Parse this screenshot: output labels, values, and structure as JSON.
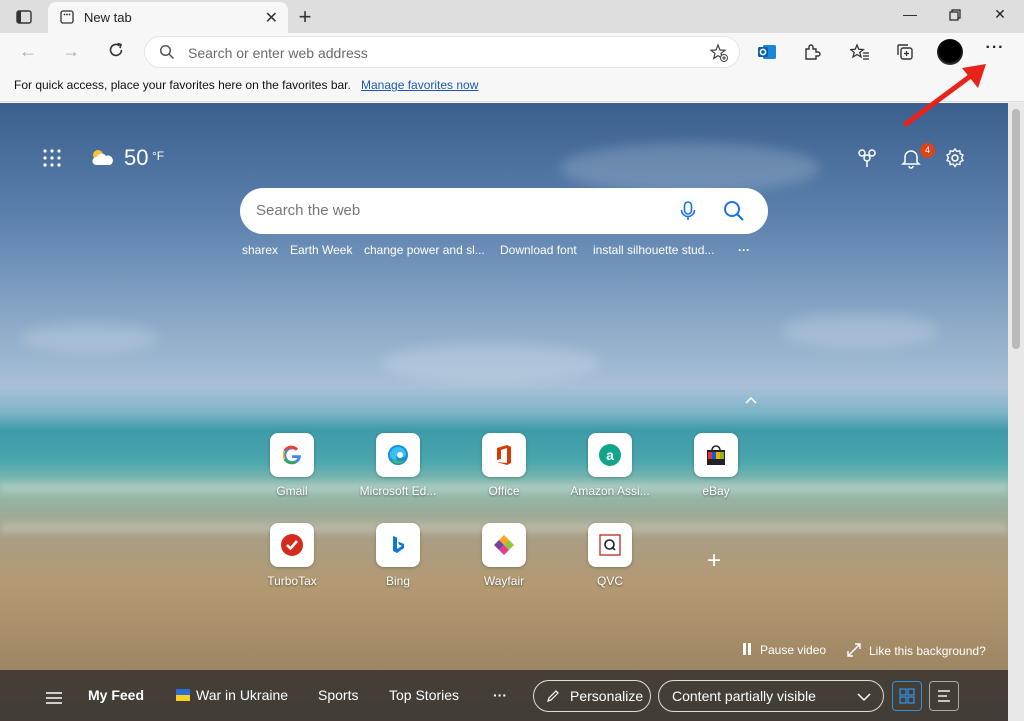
{
  "tab": {
    "title": "New tab"
  },
  "address": {
    "placeholder": "Search or enter web address"
  },
  "favorites_bar": {
    "message": "For quick access, place your favorites here on the favorites bar.",
    "link": "Manage favorites now"
  },
  "weather": {
    "temp": "50",
    "unit": "°F"
  },
  "notifications": {
    "count": "4"
  },
  "search": {
    "placeholder": "Search the web"
  },
  "trending": [
    "sharex",
    "Earth Week",
    "change power and sl...",
    "Download font",
    "install silhouette stud...",
    "···"
  ],
  "quick_links": [
    {
      "label": "Gmail"
    },
    {
      "label": "Microsoft Ed..."
    },
    {
      "label": "Office"
    },
    {
      "label": "Amazon Assi..."
    },
    {
      "label": "eBay"
    },
    {
      "label": "TurboTax"
    },
    {
      "label": "Bing"
    },
    {
      "label": "Wayfair"
    },
    {
      "label": "QVC"
    }
  ],
  "background": {
    "pause": "Pause video",
    "like": "Like this background?"
  },
  "feed": {
    "my_feed": "My Feed",
    "items": [
      "War in Ukraine",
      "Sports",
      "Top Stories"
    ],
    "more": "···",
    "personalize": "Personalize",
    "visibility": "Content partially visible"
  },
  "colors": {
    "accent_blue": "#1a5bb8",
    "badge": "#d7461c",
    "annotation_arrow": "#e8231a"
  }
}
